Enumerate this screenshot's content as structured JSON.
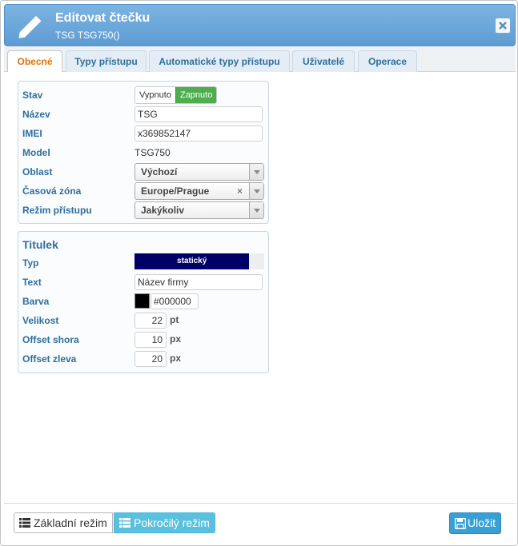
{
  "window": {
    "title": "Editovat čtečku",
    "subtitle": "TSG TSG750()",
    "close_icon": "close-icon",
    "header_icon": "pencil-icon"
  },
  "tabs": [
    {
      "label": "Obecné",
      "active": true
    },
    {
      "label": "Typy přístupu",
      "active": false
    },
    {
      "label": "Automatické typy přístupu",
      "active": false
    },
    {
      "label": "Uživatelé",
      "active": false
    },
    {
      "label": "Operace",
      "active": false
    }
  ],
  "general": {
    "stav": {
      "label": "Stav",
      "off_label": "Vypnuto",
      "on_label": "Zapnuto",
      "value": "Zapnuto"
    },
    "nazev": {
      "label": "Název",
      "value": "TSG"
    },
    "imei": {
      "label": "IMEI",
      "value": "x369852147"
    },
    "model": {
      "label": "Model",
      "value": "TSG750"
    },
    "oblast": {
      "label": "Oblast",
      "value": "Výchozí"
    },
    "casova_zona": {
      "label": "Časová zóna",
      "value": "Europe/Prague",
      "clear": "×"
    },
    "rezim_pristupu": {
      "label": "Režim přístupu",
      "value": "Jakýkoliv"
    }
  },
  "titulek": {
    "legend": "Titulek",
    "typ": {
      "label": "Typ",
      "value": "statický",
      "fill_fraction": 0.885
    },
    "text": {
      "label": "Text",
      "value": "Název firmy"
    },
    "barva": {
      "label": "Barva",
      "value": "#000000",
      "swatch_color": "#000000"
    },
    "velikost": {
      "label": "Velikost",
      "value": "22",
      "unit": "pt"
    },
    "offset_shora": {
      "label": "Offset shora",
      "value": "10",
      "unit": "px"
    },
    "offset_zleva": {
      "label": "Offset zleva",
      "value": "20",
      "unit": "px"
    }
  },
  "footer": {
    "basic_mode_label": "Základní režim",
    "advanced_mode_label": "Pokročilý režim",
    "save_label": "Uložit",
    "basic_icon": "list-icon",
    "advanced_icon": "list-icon",
    "save_icon": "floppy-disk-icon"
  },
  "colors": {
    "accent": "#5e9cd3",
    "active_tab_text": "#e17009",
    "label_text": "#2e6e9e",
    "toggle_on": "#4cae4c",
    "save_button": "#39a0d5",
    "advanced_button": "#5bc0de"
  }
}
